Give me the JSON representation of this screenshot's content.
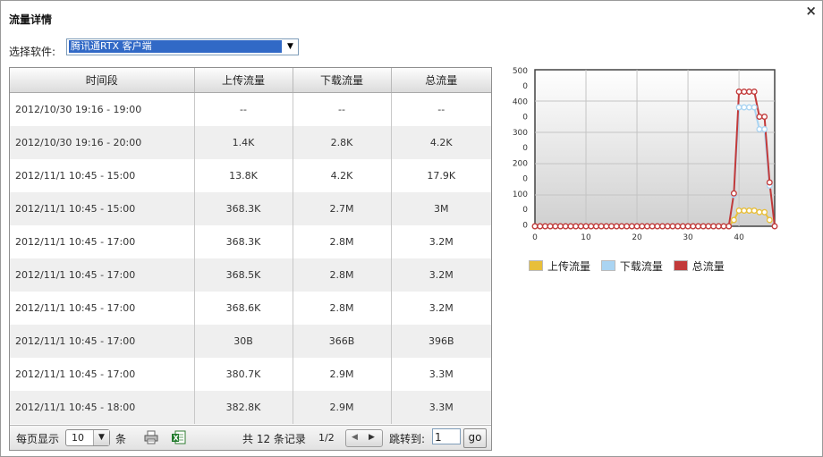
{
  "window": {
    "title": "流量详情",
    "close_glyph": "×"
  },
  "selector": {
    "label": "选择软件:",
    "value": "腾讯通RTX 客户端",
    "arrow": "▼"
  },
  "table": {
    "columns": [
      "时间段",
      "上传流量",
      "下载流量",
      "总流量"
    ],
    "rows": [
      [
        "2012/10/30 19:16 - 19:00",
        "--",
        "--",
        "--"
      ],
      [
        "2012/10/30 19:16 - 20:00",
        "1.4K",
        "2.8K",
        "4.2K"
      ],
      [
        "2012/11/1 10:45 - 15:00",
        "13.8K",
        "4.2K",
        "17.9K"
      ],
      [
        "2012/11/1 10:45 - 15:00",
        "368.3K",
        "2.7M",
        "3M"
      ],
      [
        "2012/11/1 10:45 - 17:00",
        "368.3K",
        "2.8M",
        "3.2M"
      ],
      [
        "2012/11/1 10:45 - 17:00",
        "368.5K",
        "2.8M",
        "3.2M"
      ],
      [
        "2012/11/1 10:45 - 17:00",
        "368.6K",
        "2.8M",
        "3.2M"
      ],
      [
        "2012/11/1 10:45 - 17:00",
        "30B",
        "366B",
        "396B"
      ],
      [
        "2012/11/1 10:45 - 17:00",
        "380.7K",
        "2.9M",
        "3.3M"
      ],
      [
        "2012/11/1 10:45 - 18:00",
        "382.8K",
        "2.9M",
        "3.3M"
      ]
    ]
  },
  "pager": {
    "per_page_label": "每页显示",
    "per_page_value": "10",
    "per_page_unit": "条",
    "total_text": "共 12 条记录",
    "page_text": "1/2",
    "jump_label": "跳转到:",
    "jump_value": "1",
    "go_label": "go",
    "print_icon": "printer-icon",
    "excel_icon": "excel-icon"
  },
  "chart_data": {
    "type": "line",
    "ytick_labels": [
      "500",
      "0",
      "400",
      "0",
      "300",
      "0",
      "200",
      "0",
      "100",
      "0",
      "0"
    ],
    "xtick_labels": [
      "0",
      "10",
      "20",
      "30",
      "40"
    ],
    "xlim": [
      0,
      47
    ],
    "ylim": [
      0,
      500
    ],
    "grid": true,
    "legend_position": "bottom",
    "series": [
      {
        "name": "上传流量",
        "color": "#e8bf3a",
        "x": [
          0,
          1,
          2,
          3,
          4,
          5,
          6,
          7,
          8,
          9,
          10,
          11,
          12,
          13,
          14,
          15,
          16,
          17,
          18,
          19,
          20,
          21,
          22,
          23,
          24,
          25,
          26,
          27,
          28,
          29,
          30,
          31,
          32,
          33,
          34,
          35,
          36,
          37,
          38,
          39,
          40,
          41,
          42,
          43,
          44,
          45,
          46
        ],
        "y": [
          0,
          0,
          0,
          0,
          0,
          0,
          0,
          0,
          0,
          0,
          0,
          0,
          0,
          0,
          0,
          0,
          0,
          0,
          0,
          0,
          0,
          0,
          0,
          0,
          0,
          0,
          0,
          0,
          0,
          0,
          0,
          0,
          0,
          0,
          0,
          0,
          0,
          0,
          0,
          20,
          50,
          50,
          50,
          50,
          45,
          45,
          20
        ]
      },
      {
        "name": "下载流量",
        "color": "#aad4f2",
        "x": [
          0,
          1,
          2,
          3,
          4,
          5,
          6,
          7,
          8,
          9,
          10,
          11,
          12,
          13,
          14,
          15,
          16,
          17,
          18,
          19,
          20,
          21,
          22,
          23,
          24,
          25,
          26,
          27,
          28,
          29,
          30,
          31,
          32,
          33,
          34,
          35,
          36,
          37,
          38,
          39,
          40,
          41,
          42,
          43,
          44,
          45,
          46
        ],
        "y": [
          0,
          0,
          0,
          0,
          0,
          0,
          0,
          0,
          0,
          0,
          0,
          0,
          0,
          0,
          0,
          0,
          0,
          0,
          0,
          0,
          0,
          0,
          0,
          0,
          0,
          0,
          0,
          0,
          0,
          0,
          0,
          0,
          0,
          0,
          0,
          0,
          0,
          0,
          0,
          100,
          380,
          380,
          380,
          380,
          310,
          310,
          130
        ]
      },
      {
        "name": "总流量",
        "color": "#c23a3a",
        "x": [
          0,
          1,
          2,
          3,
          4,
          5,
          6,
          7,
          8,
          9,
          10,
          11,
          12,
          13,
          14,
          15,
          16,
          17,
          18,
          19,
          20,
          21,
          22,
          23,
          24,
          25,
          26,
          27,
          28,
          29,
          30,
          31,
          32,
          33,
          34,
          35,
          36,
          37,
          38,
          39,
          40,
          41,
          42,
          43,
          44,
          45,
          46,
          47
        ],
        "y": [
          0,
          0,
          0,
          0,
          0,
          0,
          0,
          0,
          0,
          0,
          0,
          0,
          0,
          0,
          0,
          0,
          0,
          0,
          0,
          0,
          0,
          0,
          0,
          0,
          0,
          0,
          0,
          0,
          0,
          0,
          0,
          0,
          0,
          0,
          0,
          0,
          0,
          0,
          0,
          105,
          430,
          430,
          430,
          430,
          350,
          350,
          140,
          0
        ]
      }
    ]
  }
}
